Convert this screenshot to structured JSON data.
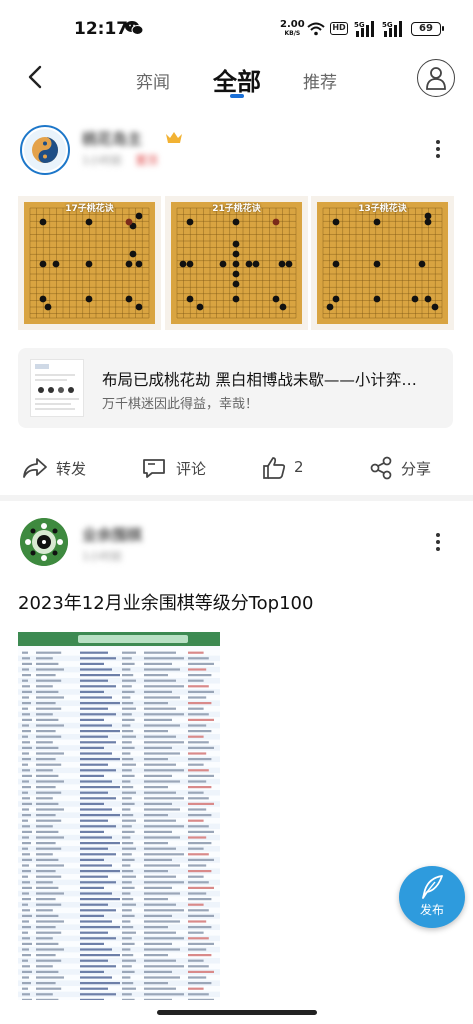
{
  "status_bar": {
    "time": "12:17",
    "net_speed": "2.00",
    "net_speed_unit": "KB/S",
    "hd_label": "HD",
    "signal_label": "5G",
    "battery": "69",
    "icons": [
      "wechat-icon",
      "wifi-icon",
      "signal-icon",
      "battery-icon"
    ]
  },
  "nav": {
    "tabs": [
      {
        "label": "弈闻",
        "active": false
      },
      {
        "label": "全部",
        "active": true
      },
      {
        "label": "推荐",
        "active": false
      }
    ],
    "accent_color": "#1a6fd6"
  },
  "posts": [
    {
      "author": "桃花岛主",
      "meta": "1小时前",
      "tag": "置顶",
      "boards": [
        "17子桃花诀",
        "21子桃花诀",
        "13子桃花诀"
      ],
      "link_card": {
        "title": "布局已成桃花劫 黑白相博战未歇——小计弈…",
        "subtitle": "万千棋迷因此得益，幸哉！"
      },
      "actions": {
        "share": "转发",
        "comment": "评论",
        "likes": "2",
        "forward": "分享"
      }
    },
    {
      "author": "业余围棋",
      "meta": "1小时前",
      "text": "2023年12月业余围棋等级分Top100"
    }
  ],
  "publish_button": {
    "label": "发布",
    "color": "#2e9bdd"
  }
}
